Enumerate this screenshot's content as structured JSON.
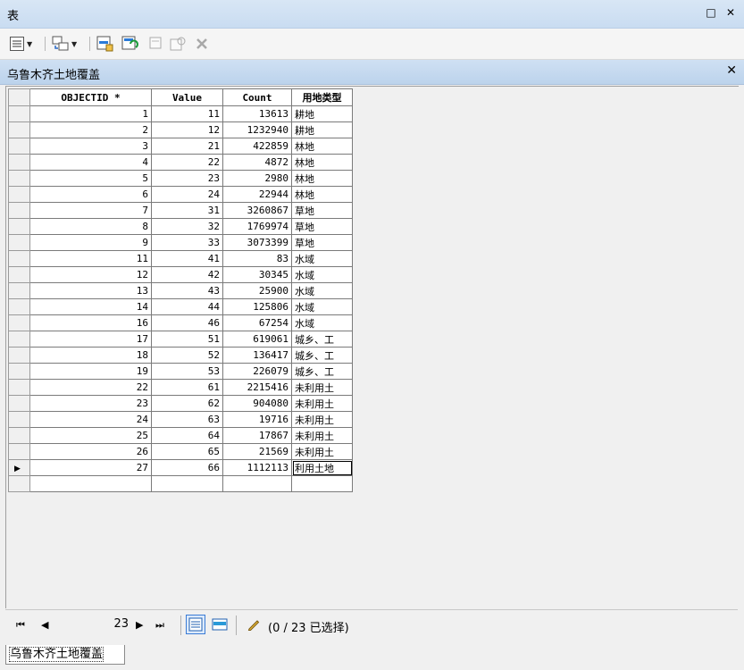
{
  "window": {
    "title": "表",
    "restore_glyph": "□",
    "close_glyph": "✕"
  },
  "table_tab": {
    "title": "乌鲁木齐土地覆盖",
    "close_glyph": "✕"
  },
  "columns": [
    "OBJECTID *",
    "Value",
    "Count",
    "用地类型"
  ],
  "rows": [
    {
      "objectid": "1",
      "value": "11",
      "count": "13613",
      "type": "耕地"
    },
    {
      "objectid": "2",
      "value": "12",
      "count": "1232940",
      "type": "耕地"
    },
    {
      "objectid": "3",
      "value": "21",
      "count": "422859",
      "type": "林地"
    },
    {
      "objectid": "4",
      "value": "22",
      "count": "4872",
      "type": "林地"
    },
    {
      "objectid": "5",
      "value": "23",
      "count": "2980",
      "type": "林地"
    },
    {
      "objectid": "6",
      "value": "24",
      "count": "22944",
      "type": "林地"
    },
    {
      "objectid": "7",
      "value": "31",
      "count": "3260867",
      "type": "草地"
    },
    {
      "objectid": "8",
      "value": "32",
      "count": "1769974",
      "type": "草地"
    },
    {
      "objectid": "9",
      "value": "33",
      "count": "3073399",
      "type": "草地"
    },
    {
      "objectid": "11",
      "value": "41",
      "count": "83",
      "type": "水域"
    },
    {
      "objectid": "12",
      "value": "42",
      "count": "30345",
      "type": "水域"
    },
    {
      "objectid": "13",
      "value": "43",
      "count": "25900",
      "type": "水域"
    },
    {
      "objectid": "14",
      "value": "44",
      "count": "125806",
      "type": "水域"
    },
    {
      "objectid": "16",
      "value": "46",
      "count": "67254",
      "type": "水域"
    },
    {
      "objectid": "17",
      "value": "51",
      "count": "619061",
      "type": "城乡、工"
    },
    {
      "objectid": "18",
      "value": "52",
      "count": "136417",
      "type": "城乡、工"
    },
    {
      "objectid": "19",
      "value": "53",
      "count": "226079",
      "type": "城乡、工"
    },
    {
      "objectid": "22",
      "value": "61",
      "count": "2215416",
      "type": "未利用土"
    },
    {
      "objectid": "23",
      "value": "62",
      "count": "904080",
      "type": "未利用土"
    },
    {
      "objectid": "24",
      "value": "63",
      "count": "19716",
      "type": "未利用土"
    },
    {
      "objectid": "25",
      "value": "64",
      "count": "17867",
      "type": "未利用土"
    },
    {
      "objectid": "26",
      "value": "65",
      "count": "21569",
      "type": "未利用土"
    },
    {
      "objectid": "27",
      "value": "66",
      "count": "1112113",
      "type": "利用土地",
      "editing": true
    }
  ],
  "navigator": {
    "first_glyph": "⏮",
    "prev_glyph": "◀",
    "record": "23",
    "next_glyph": "▶",
    "last_glyph": "⏭",
    "selection_text": "(0 / 23 已选择)"
  },
  "bottom_tab": {
    "label": "乌鲁木齐土地覆盖"
  }
}
